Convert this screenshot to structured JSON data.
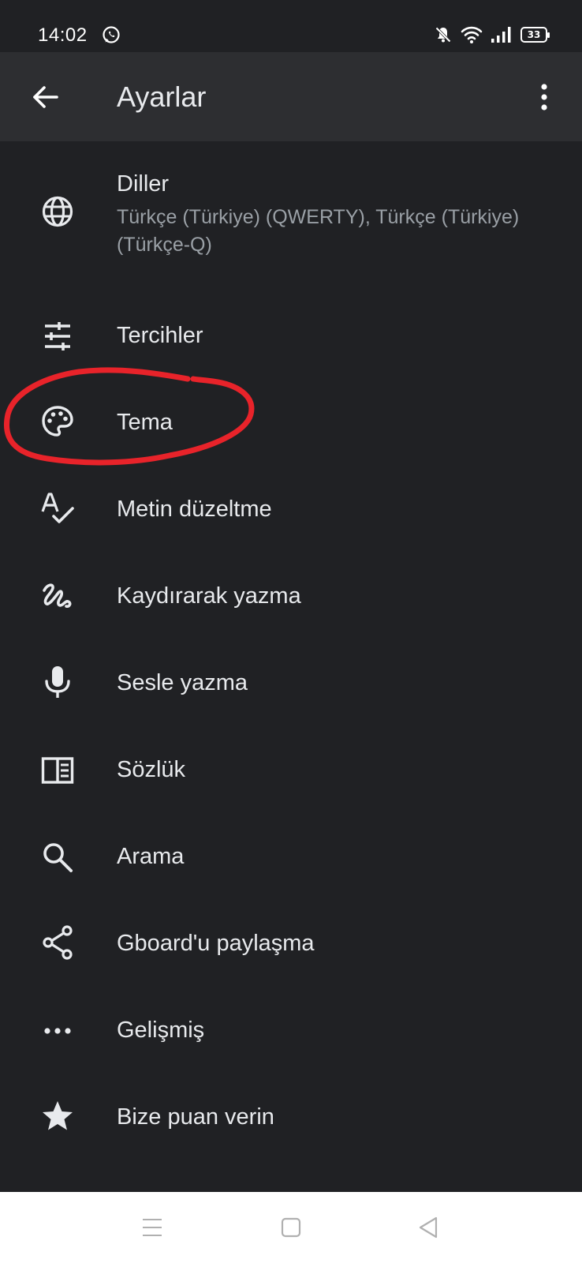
{
  "status_bar": {
    "time": "14:02",
    "battery_level": "33"
  },
  "app_bar": {
    "title": "Ayarlar"
  },
  "settings": [
    {
      "label": "Diller",
      "summary": "Türkçe (Türkiye) (QWERTY), Türkçe (Türkiye) (Türkçe-Q)",
      "icon": "globe-icon"
    },
    {
      "label": "Tercihler",
      "icon": "tune-icon"
    },
    {
      "label": "Tema",
      "icon": "palette-icon"
    },
    {
      "label": "Metin düzeltme",
      "icon": "spellcheck-icon"
    },
    {
      "label": "Kaydırarak yazma",
      "icon": "gesture-icon"
    },
    {
      "label": "Sesle yazma",
      "icon": "mic-icon"
    },
    {
      "label": "Sözlük",
      "icon": "dictionary-icon"
    },
    {
      "label": "Arama",
      "icon": "search-icon"
    },
    {
      "label": "Gboard'u paylaşma",
      "icon": "share-icon"
    },
    {
      "label": "Gelişmiş",
      "icon": "more-horiz-icon"
    },
    {
      "label": "Bize puan verin",
      "icon": "star-icon"
    }
  ],
  "colors": {
    "background": "#202124",
    "app_bar": "#2d2e31",
    "text_primary": "#e8eaed",
    "text_secondary": "#9aa0a6",
    "icon": "#e8eaed",
    "annotation": "#e8232a",
    "nav_bar": "#ffffff"
  }
}
